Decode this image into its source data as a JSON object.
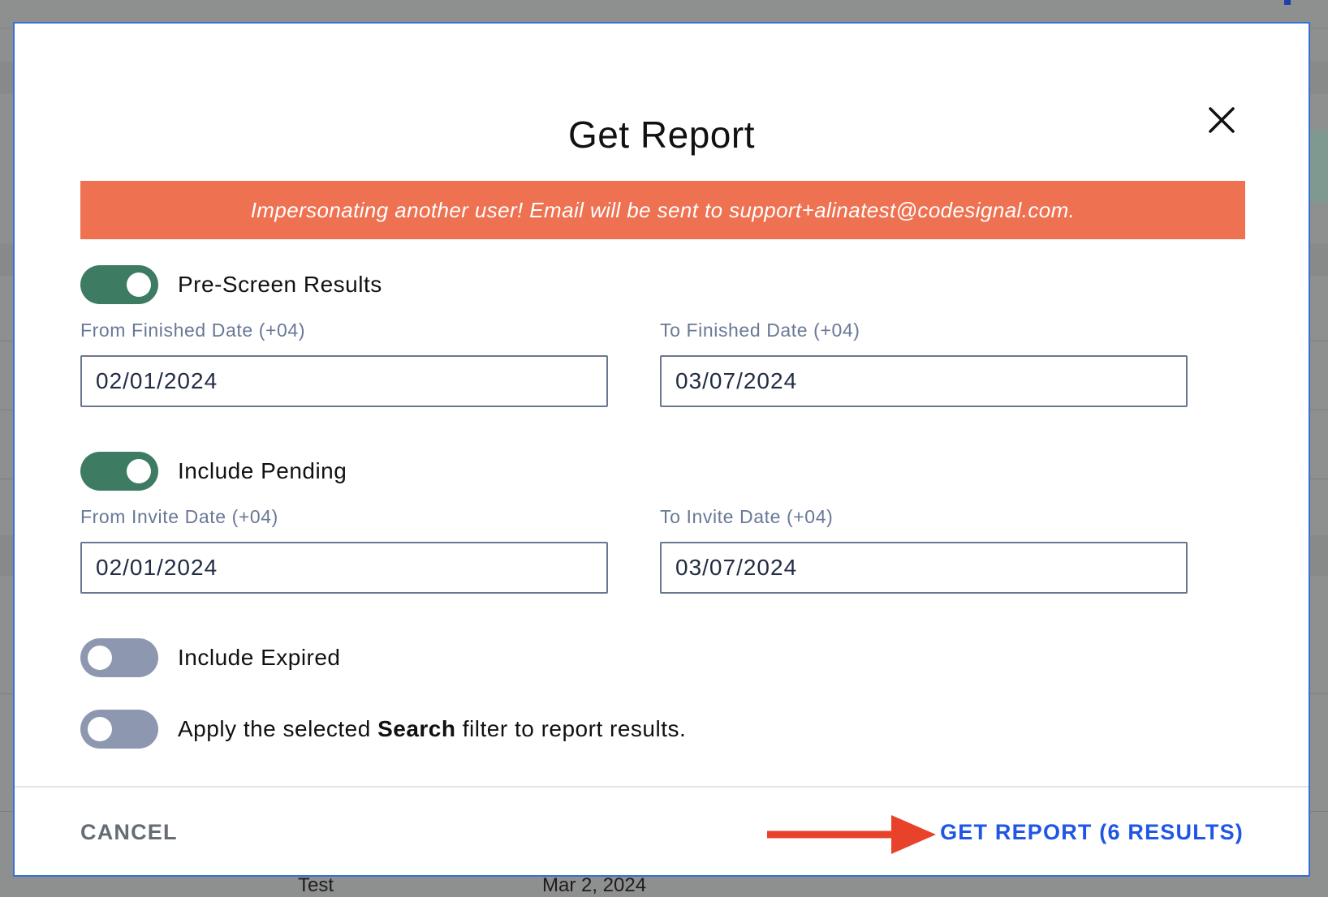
{
  "modal": {
    "title": "Get Report",
    "banner": "Impersonating another user! Email will be sent to support+alinatest@codesignal.com.",
    "options": {
      "pre_screen": {
        "label": "Pre-Screen Results",
        "enabled": true,
        "from_label": "From Finished Date (+04)",
        "from_value": "02/01/2024",
        "to_label": "To Finished Date (+04)",
        "to_value": "03/07/2024"
      },
      "pending": {
        "label": "Include Pending",
        "enabled": true,
        "from_label": "From Invite Date (+04)",
        "from_value": "02/01/2024",
        "to_label": "To Invite Date (+04)",
        "to_value": "03/07/2024"
      },
      "expired": {
        "label": "Include Expired",
        "enabled": false
      },
      "search_filter": {
        "label_prefix": "Apply the selected ",
        "label_bold": "Search",
        "label_suffix": " filter to report results.",
        "enabled": false
      }
    },
    "footer": {
      "cancel_label": "CANCEL",
      "submit_label": "GET REPORT (6 RESULTS)"
    },
    "icons": {
      "close": "close-icon",
      "annotation": "red-arrow-annotation"
    }
  },
  "background": {
    "text_1": "Test",
    "text_2": "Mar 2, 2024"
  },
  "colors": {
    "accent": "#1f56e5",
    "toggle_on": "#3d7b62",
    "toggle_off": "#8d97b0",
    "banner": "#ee7151",
    "arrow": "#e8432a"
  }
}
